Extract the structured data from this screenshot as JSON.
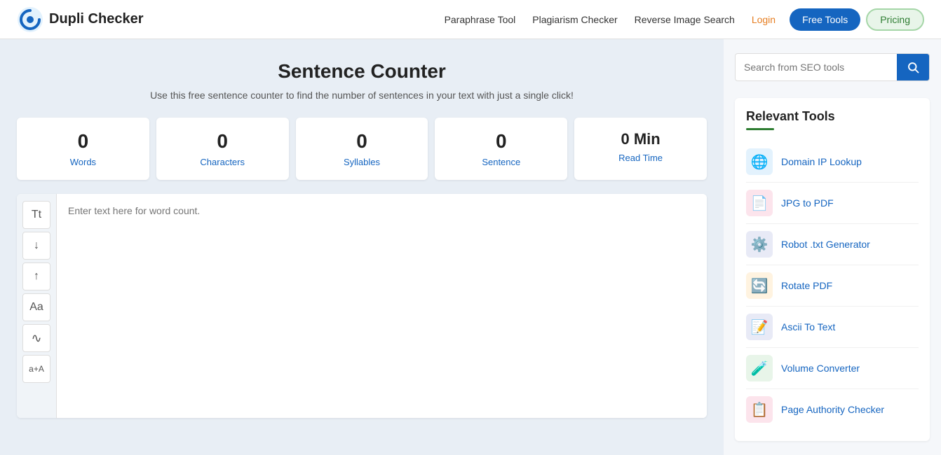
{
  "header": {
    "logo_text": "Dupli Checker",
    "nav": {
      "links": [
        {
          "label": "Paraphrase Tool",
          "name": "paraphrase-tool-link"
        },
        {
          "label": "Plagiarism Checker",
          "name": "plagiarism-checker-link"
        },
        {
          "label": "Reverse Image Search",
          "name": "reverse-image-search-link"
        },
        {
          "label": "Login",
          "name": "login-link"
        }
      ],
      "free_tools_label": "Free Tools",
      "pricing_label": "Pricing"
    }
  },
  "main": {
    "title": "Sentence Counter",
    "subtitle": "Use this free sentence counter to find the number of sentences in your text with just a single click!",
    "stats": [
      {
        "value": "0",
        "label": "Words",
        "name": "words-stat"
      },
      {
        "value": "0",
        "label": "Characters",
        "name": "characters-stat"
      },
      {
        "value": "0",
        "label": "Syllables",
        "name": "syllables-stat"
      },
      {
        "value": "0",
        "label": "Sentence",
        "name": "sentence-stat"
      },
      {
        "value": "0 Min",
        "label": "Read Time",
        "name": "read-time-stat"
      }
    ],
    "textarea_placeholder": "Enter text here for word count."
  },
  "toolbar": {
    "buttons": [
      {
        "label": "Tt",
        "name": "font-size-button",
        "title": "Font Size"
      },
      {
        "label": "↓",
        "name": "decrease-button",
        "title": "Decrease"
      },
      {
        "label": "↑",
        "name": "increase-button",
        "title": "Increase"
      },
      {
        "label": "Aa",
        "name": "case-button",
        "title": "Case"
      },
      {
        "label": "~",
        "name": "special-button",
        "title": "Special"
      },
      {
        "label": "a+A",
        "name": "merge-button",
        "title": "Merge"
      }
    ]
  },
  "sidebar": {
    "search_placeholder": "Search from SEO tools",
    "relevant_tools_title": "Relevant Tools",
    "tools": [
      {
        "label": "Domain IP Lookup",
        "icon": "🌐",
        "icon_class": "icon-globe",
        "name": "domain-ip-lookup-tool"
      },
      {
        "label": "JPG to PDF",
        "icon": "📄",
        "icon_class": "icon-pdf",
        "name": "jpg-to-pdf-tool"
      },
      {
        "label": "Robot .txt Generator",
        "icon": "⚙️",
        "icon_class": "icon-robot",
        "name": "robot-txt-generator-tool"
      },
      {
        "label": "Rotate PDF",
        "icon": "🔄",
        "icon_class": "icon-rotate",
        "name": "rotate-pdf-tool"
      },
      {
        "label": "Ascii To Text",
        "icon": "📝",
        "icon_class": "icon-ascii",
        "name": "ascii-to-text-tool"
      },
      {
        "label": "Volume Converter",
        "icon": "🧪",
        "icon_class": "icon-volume",
        "name": "volume-converter-tool"
      },
      {
        "label": "Page Authority Checker",
        "icon": "📋",
        "icon_class": "icon-pa",
        "name": "page-authority-checker-tool"
      }
    ]
  }
}
